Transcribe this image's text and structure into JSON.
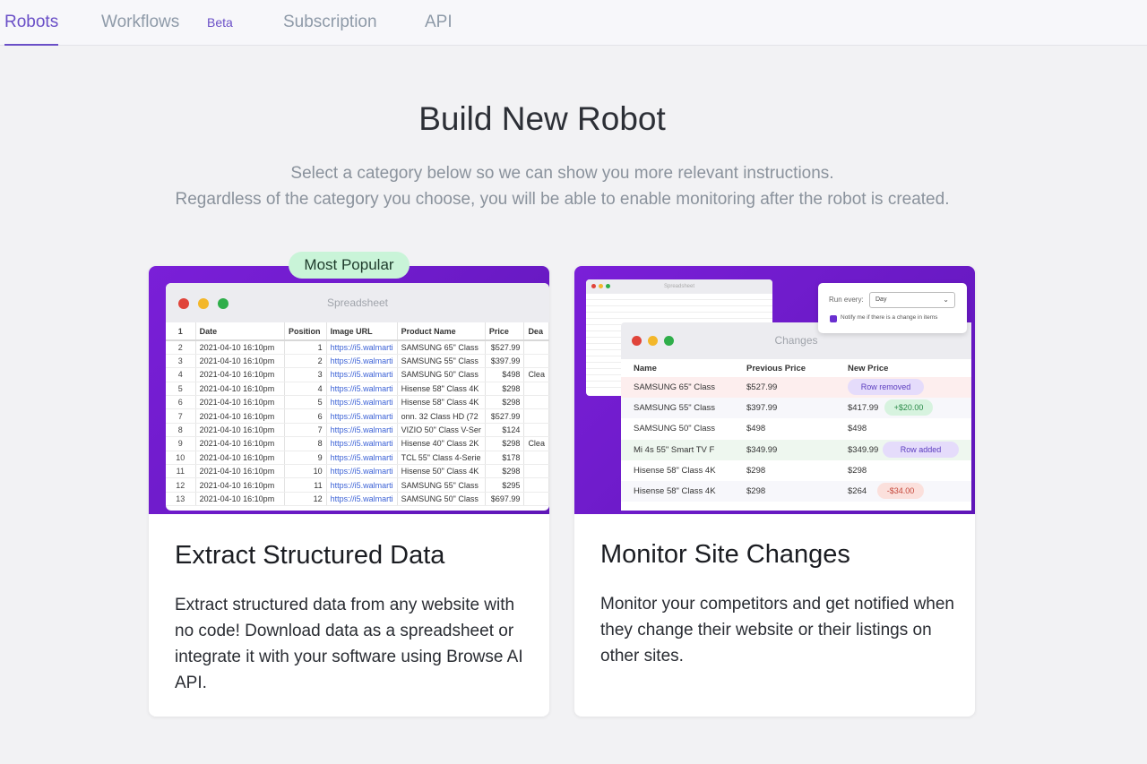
{
  "nav": {
    "tabs": [
      {
        "label": "Robots",
        "active": true
      },
      {
        "label": "Workflows",
        "active": false
      },
      {
        "label": "Subscription",
        "active": false
      },
      {
        "label": "API",
        "active": false
      }
    ],
    "beta_label": "Beta"
  },
  "page": {
    "title": "Build New Robot",
    "subtitle_line1": "Select a category below so we can show you more relevant instructions.",
    "subtitle_line2": "Regardless of the category you choose, you will be able to enable monitoring after the robot is created."
  },
  "cards": {
    "extract": {
      "badge": "Most Popular",
      "title": "Extract Structured Data",
      "description": "Extract structured data from any website with no code! Download data as a spreadsheet or integrate it with your software using Browse AI API.",
      "window_title": "Spreadsheet",
      "sheet_headers": [
        "1",
        "Date",
        "Position",
        "Image URL",
        "Product Name",
        "Price",
        "Dea"
      ],
      "sheet_rows": [
        [
          "2",
          "2021-04-10 16:10pm",
          "1",
          "https://i5.walmarti",
          "SAMSUNG 65\" Class",
          "$527.99",
          ""
        ],
        [
          "3",
          "2021-04-10 16:10pm",
          "2",
          "https://i5.walmarti",
          "SAMSUNG 55\" Class",
          "$397.99",
          ""
        ],
        [
          "4",
          "2021-04-10 16:10pm",
          "3",
          "https://i5.walmarti",
          "SAMSUNG 50\" Class",
          "$498",
          "Clea"
        ],
        [
          "5",
          "2021-04-10 16:10pm",
          "4",
          "https://i5.walmarti",
          "Hisense 58\" Class 4K",
          "$298",
          ""
        ],
        [
          "6",
          "2021-04-10 16:10pm",
          "5",
          "https://i5.walmarti",
          "Hisense 58\" Class 4K",
          "$298",
          ""
        ],
        [
          "7",
          "2021-04-10 16:10pm",
          "6",
          "https://i5.walmarti",
          "onn. 32 Class HD (72",
          "$527.99",
          ""
        ],
        [
          "8",
          "2021-04-10 16:10pm",
          "7",
          "https://i5.walmarti",
          "VIZIO 50\" Class V-Ser",
          "$124",
          ""
        ],
        [
          "9",
          "2021-04-10 16:10pm",
          "8",
          "https://i5.walmarti",
          "Hisense 40\" Class 2K",
          "$298",
          "Clea"
        ],
        [
          "10",
          "2021-04-10 16:10pm",
          "9",
          "https://i5.walmarti",
          "TCL 55\" Class 4-Serie",
          "$178",
          ""
        ],
        [
          "11",
          "2021-04-10 16:10pm",
          "10",
          "https://i5.walmarti",
          "Hisense 50\" Class 4K",
          "$298",
          ""
        ],
        [
          "12",
          "2021-04-10 16:10pm",
          "11",
          "https://i5.walmarti",
          "SAMSUNG 55\" Class",
          "$295",
          ""
        ],
        [
          "13",
          "2021-04-10 16:10pm",
          "12",
          "https://i5.walmarti",
          "SAMSUNG 50\" Class",
          "$697.99",
          ""
        ]
      ]
    },
    "monitor": {
      "title": "Monitor Site Changes",
      "description": "Monitor your competitors and get notified when they change their website or their listings on other sites.",
      "mini_title": "Spreadsheet",
      "popover": {
        "run_label": "Run every:",
        "select_value": "Day",
        "notify_label": "Notify me if there is a change in items"
      },
      "changes_title": "Changes",
      "headers": {
        "name": "Name",
        "previous": "Previous Price",
        "new": "New Price"
      },
      "rows": [
        {
          "name": "SAMSUNG 65\" Class",
          "prev": "$527.99",
          "new": "",
          "pill": "Row removed"
        },
        {
          "name": "SAMSUNG 55\" Class",
          "prev": "$397.99",
          "new": "$417.99",
          "pill": "+$20.00"
        },
        {
          "name": "SAMSUNG 50\" Class",
          "prev": "$498",
          "new": "$498",
          "pill": ""
        },
        {
          "name": "Mi 4s 55\" Smart TV F",
          "prev": "$349.99",
          "new": "$349.99",
          "pill": "Row added"
        },
        {
          "name": "Hisense 58\" Class 4K",
          "prev": "$298",
          "new": "$298",
          "pill": ""
        },
        {
          "name": "Hisense 58\" Class 4K",
          "prev": "$298",
          "new": "$264",
          "pill": "-$34.00"
        }
      ]
    }
  },
  "colors": {
    "accent": "#6a4fc7",
    "card_header": "#7a1fd8",
    "badge_bg": "#c9f4d8",
    "removed_row": "#fdeeee",
    "added_row": "#eef7ef",
    "purple_pill": "#e5dcfb",
    "green_pill": "#d7f3df",
    "red_pill": "#fbe0dc"
  }
}
